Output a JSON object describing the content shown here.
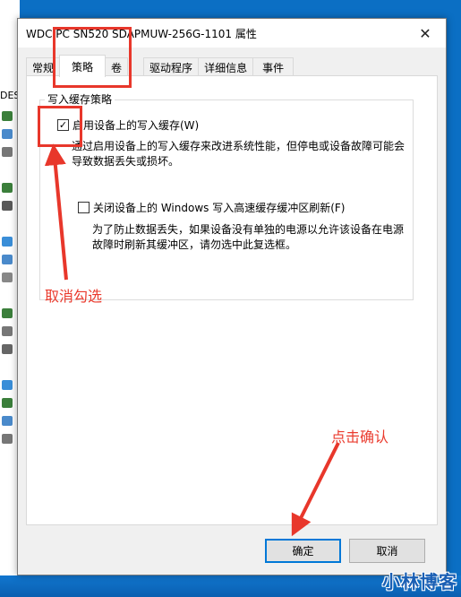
{
  "background": {
    "left_label": "DES"
  },
  "dialog": {
    "title": "WDC PC SN520 SDAPMUW-256G-1101 属性",
    "close_glyph": "✕",
    "tabs": [
      {
        "label": "常规",
        "active": false
      },
      {
        "label": "策略",
        "active": true
      },
      {
        "label": "卷",
        "active": false
      },
      {
        "label": "驱动程序",
        "active": false
      },
      {
        "label": "详细信息",
        "active": false
      },
      {
        "label": "事件",
        "active": false
      }
    ],
    "group_title": "写入缓存策略",
    "option1": {
      "checked": true,
      "label": "启用设备上的写入缓存(W)",
      "desc_line1": "通过启用设备上的写入缓存来改进系统性能，但停电或设备故障可能会",
      "desc_line2": "导致数据丢失或损坏。"
    },
    "option2": {
      "checked": false,
      "label": "关闭设备上的 Windows 写入高速缓存缓冲区刷新(F)",
      "desc_line1": "为了防止数据丢失，如果设备没有单独的电源以允许该设备在电源",
      "desc_line2": "故障时刷新其缓冲区，请勿选中此复选框。"
    },
    "ok_label": "确定",
    "cancel_label": "取消"
  },
  "annotations": {
    "uncheck_text": "取消勾选",
    "confirm_text": "点击确认",
    "color": "#e8372b"
  },
  "watermark": "小林博客"
}
